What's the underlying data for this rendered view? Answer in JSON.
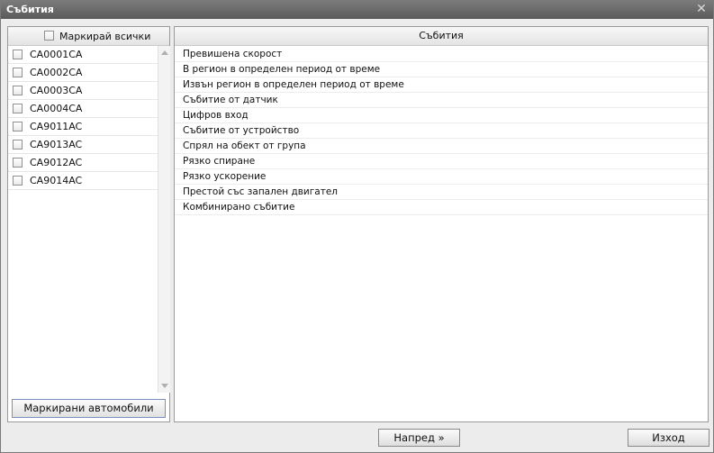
{
  "window": {
    "title": "Събития",
    "close_glyph": "✕"
  },
  "vehicles": {
    "select_all_label": "Маркирай всички",
    "items": [
      {
        "label": "CA0001CA"
      },
      {
        "label": "CA0002CA"
      },
      {
        "label": "CA0003CA"
      },
      {
        "label": "CA0004CA"
      },
      {
        "label": "CA9011AC"
      },
      {
        "label": "CA9013AC"
      },
      {
        "label": "CA9012AC"
      },
      {
        "label": "CA9014AC"
      }
    ],
    "marked_button_label": "Маркирани автомобили"
  },
  "events": {
    "header": "Събития",
    "items": [
      {
        "label": "Превишена скорост"
      },
      {
        "label": "В регион в определен период от време"
      },
      {
        "label": "Извън регион в определен период от време"
      },
      {
        "label": "Събитие от датчик"
      },
      {
        "label": "Цифров вход"
      },
      {
        "label": "Събитие от устройство"
      },
      {
        "label": "Спрял на обект от група"
      },
      {
        "label": "Рязко спиране"
      },
      {
        "label": "Рязко ускорение"
      },
      {
        "label": "Престой със запален двигател"
      },
      {
        "label": "Комбинирано събитие"
      }
    ]
  },
  "footer": {
    "next_label": "Напред »",
    "exit_label": "Изход"
  }
}
